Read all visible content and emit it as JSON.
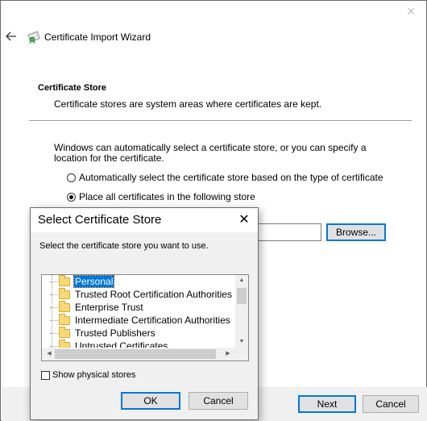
{
  "wizard": {
    "title": "Certificate Import Wizard",
    "section_title": "Certificate Store",
    "section_desc": "Certificate stores are system areas where certificates are kept.",
    "explain": "Windows can automatically select a certificate store, or you can specify a location for the certificate.",
    "radio_auto": "Automatically select the certificate store based on the type of certificate",
    "radio_place": "Place all certificates in the following store",
    "radio_selected": "place",
    "store_value": "",
    "browse_label": "Browse...",
    "next_label": "Next",
    "cancel_label": "Cancel",
    "close_glyph": "✕",
    "back_icon": "back-arrow-icon",
    "wizard_icon": "certificate-icon"
  },
  "dialog": {
    "title": "Select Certificate Store",
    "close_glyph": "✕",
    "instruction": "Select the certificate store you want to use.",
    "stores": [
      {
        "label": "Personal",
        "selected": true
      },
      {
        "label": "Trusted Root Certification Authorities",
        "selected": false
      },
      {
        "label": "Enterprise Trust",
        "selected": false
      },
      {
        "label": "Intermediate Certification Authorities",
        "selected": false
      },
      {
        "label": "Trusted Publishers",
        "selected": false
      },
      {
        "label": "Untrusted Certificates",
        "selected": false
      }
    ],
    "show_physical_label": "Show physical stores",
    "show_physical_checked": false,
    "ok_label": "OK",
    "cancel_label": "Cancel"
  },
  "colors": {
    "accent": "#0078d7",
    "footer_bg": "#f0f0f0",
    "folder": "#f8d775"
  }
}
